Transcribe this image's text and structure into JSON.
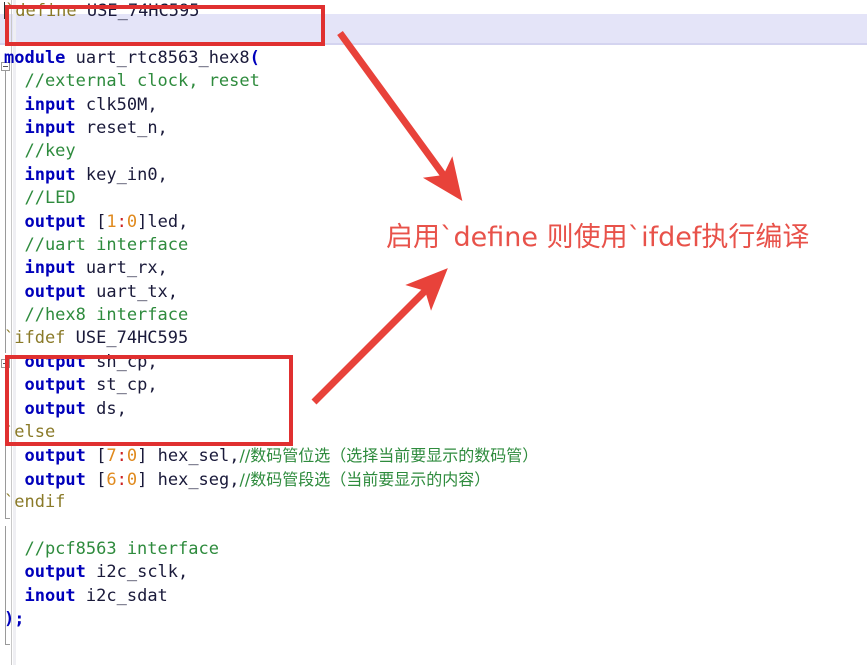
{
  "editor": {
    "title": "verilog-source-view",
    "language": "Verilog",
    "colors": {
      "keyword": "#0000bb",
      "directive": "#8a7a28",
      "comment": "#2e8b3d",
      "number": "#e08a1e",
      "identifier": "#1a1a3a",
      "current_line_highlight": "#e4e4f8",
      "annotation_red": "#e03030",
      "annotation_text_red": "#e8524a",
      "background": "#ffffff"
    },
    "lines": [
      {
        "n": 1,
        "tokens": [
          {
            "t": "`define ",
            "c": "dir"
          },
          {
            "t": "USE_74HC595",
            "c": "ident"
          }
        ]
      },
      {
        "n": 2,
        "tokens": []
      },
      {
        "n": 3,
        "tokens": [
          {
            "t": "module",
            "c": "kw"
          },
          {
            "t": " uart_rtc8563_hex8",
            "c": "ident"
          },
          {
            "t": "(",
            "c": "paren"
          }
        ]
      },
      {
        "n": 4,
        "tokens": [
          {
            "t": "  //external clock, reset",
            "c": "cmt"
          }
        ]
      },
      {
        "n": 5,
        "tokens": [
          {
            "t": "  ",
            "c": "punc"
          },
          {
            "t": "input",
            "c": "kw"
          },
          {
            "t": " clk50M,",
            "c": "ident"
          }
        ]
      },
      {
        "n": 6,
        "tokens": [
          {
            "t": "  ",
            "c": "punc"
          },
          {
            "t": "input",
            "c": "kw"
          },
          {
            "t": " reset_n,",
            "c": "ident"
          }
        ]
      },
      {
        "n": 7,
        "tokens": [
          {
            "t": "  //key",
            "c": "cmt"
          }
        ]
      },
      {
        "n": 8,
        "tokens": [
          {
            "t": "  ",
            "c": "punc"
          },
          {
            "t": "input",
            "c": "kw"
          },
          {
            "t": " key_in0,",
            "c": "ident"
          }
        ]
      },
      {
        "n": 9,
        "tokens": [
          {
            "t": "  //LED",
            "c": "cmt"
          }
        ]
      },
      {
        "n": 10,
        "tokens": [
          {
            "t": "  ",
            "c": "punc"
          },
          {
            "t": "output",
            "c": "kw"
          },
          {
            "t": " [",
            "c": "punc"
          },
          {
            "t": "1",
            "c": "num"
          },
          {
            "t": ":",
            "c": "colon"
          },
          {
            "t": "0",
            "c": "num"
          },
          {
            "t": "]led,",
            "c": "punc"
          }
        ]
      },
      {
        "n": 11,
        "tokens": [
          {
            "t": "  //uart interface",
            "c": "cmt"
          }
        ]
      },
      {
        "n": 12,
        "tokens": [
          {
            "t": "  ",
            "c": "punc"
          },
          {
            "t": "input",
            "c": "kw"
          },
          {
            "t": " uart_rx,",
            "c": "ident"
          }
        ]
      },
      {
        "n": 13,
        "tokens": [
          {
            "t": "  ",
            "c": "punc"
          },
          {
            "t": "output",
            "c": "kw"
          },
          {
            "t": " uart_tx,",
            "c": "ident"
          }
        ]
      },
      {
        "n": 14,
        "tokens": [
          {
            "t": "  //hex8 interface",
            "c": "cmt"
          }
        ]
      },
      {
        "n": 15,
        "tokens": [
          {
            "t": "`ifdef ",
            "c": "dir"
          },
          {
            "t": "USE_74HC595",
            "c": "ident"
          }
        ]
      },
      {
        "n": 16,
        "tokens": [
          {
            "t": "  ",
            "c": "punc"
          },
          {
            "t": "output",
            "c": "kw"
          },
          {
            "t": " sh_cp,",
            "c": "ident"
          }
        ]
      },
      {
        "n": 17,
        "tokens": [
          {
            "t": "  ",
            "c": "punc"
          },
          {
            "t": "output",
            "c": "kw"
          },
          {
            "t": " st_cp,",
            "c": "ident"
          }
        ]
      },
      {
        "n": 18,
        "tokens": [
          {
            "t": "  ",
            "c": "punc"
          },
          {
            "t": "output",
            "c": "kw"
          },
          {
            "t": " ds,",
            "c": "ident"
          }
        ]
      },
      {
        "n": 19,
        "tokens": [
          {
            "t": "`else",
            "c": "dir"
          }
        ]
      },
      {
        "n": 20,
        "tokens": [
          {
            "t": "  ",
            "c": "punc"
          },
          {
            "t": "output",
            "c": "kw"
          },
          {
            "t": " [",
            "c": "punc"
          },
          {
            "t": "7",
            "c": "num"
          },
          {
            "t": ":",
            "c": "colon"
          },
          {
            "t": "0",
            "c": "num"
          },
          {
            "t": "] hex_sel,",
            "c": "punc"
          },
          {
            "t": "//数码管位选（选择当前要显示的数码管）",
            "c": "cmt-cn"
          }
        ]
      },
      {
        "n": 21,
        "tokens": [
          {
            "t": "  ",
            "c": "punc"
          },
          {
            "t": "output",
            "c": "kw"
          },
          {
            "t": " [",
            "c": "punc"
          },
          {
            "t": "6",
            "c": "num"
          },
          {
            "t": ":",
            "c": "colon"
          },
          {
            "t": "0",
            "c": "num"
          },
          {
            "t": "] hex_seg,",
            "c": "punc"
          },
          {
            "t": "//数码管段选（当前要显示的内容）",
            "c": "cmt-cn"
          }
        ]
      },
      {
        "n": 22,
        "tokens": [
          {
            "t": "`endif",
            "c": "dir"
          }
        ]
      },
      {
        "n": 23,
        "tokens": []
      },
      {
        "n": 24,
        "tokens": [
          {
            "t": "  //pcf8563 interface",
            "c": "cmt"
          }
        ]
      },
      {
        "n": 25,
        "tokens": [
          {
            "t": "  ",
            "c": "punc"
          },
          {
            "t": "output",
            "c": "kw"
          },
          {
            "t": " i2c_sclk,",
            "c": "ident"
          }
        ]
      },
      {
        "n": 26,
        "tokens": [
          {
            "t": "  ",
            "c": "punc"
          },
          {
            "t": "inout",
            "c": "kw"
          },
          {
            "t": " i2c_sdat",
            "c": "ident"
          }
        ]
      },
      {
        "n": 27,
        "tokens": [
          {
            "t": ")",
            "c": "paren"
          },
          {
            "t": ";",
            "c": "paren"
          }
        ]
      }
    ]
  },
  "annotations": {
    "label_text": "启用`define 则使用`ifdef执行编译",
    "box_define_label": "`define USE_74HC595",
    "box_ifdef_label": "`ifdef USE_74HC595 block",
    "arrow_from_define_label": "arrow-define-to-label",
    "arrow_to_ifdef_label": "arrow-label-to-ifdef"
  }
}
